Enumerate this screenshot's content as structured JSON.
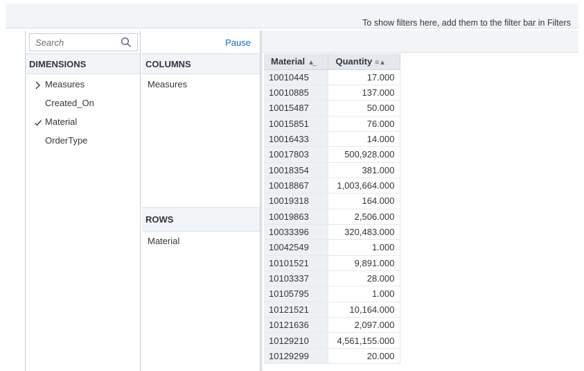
{
  "filter_bar": {
    "message": "To show filters here, add them to the filter bar in Filters"
  },
  "dimensions": {
    "search_placeholder": "Search",
    "header": "DIMENSIONS",
    "items": [
      {
        "label": "Measures",
        "marker": "›"
      },
      {
        "label": "Created_On",
        "marker": ""
      },
      {
        "label": "Material",
        "marker": "✓"
      },
      {
        "label": "OrderType",
        "marker": ""
      }
    ]
  },
  "builder": {
    "pause_label": "Pause",
    "columns_header": "COLUMNS",
    "columns_items": [
      "Measures"
    ],
    "rows_header": "ROWS",
    "rows_items": [
      "Material"
    ]
  },
  "table": {
    "headers": {
      "material": "Material",
      "quantity": "Quantity"
    },
    "rows": [
      {
        "material": "10010445",
        "quantity": "17.000"
      },
      {
        "material": "10010885",
        "quantity": "137.000"
      },
      {
        "material": "10015487",
        "quantity": "50.000"
      },
      {
        "material": "10015851",
        "quantity": "76.000"
      },
      {
        "material": "10016433",
        "quantity": "14.000"
      },
      {
        "material": "10017803",
        "quantity": "500,928.000"
      },
      {
        "material": "10018354",
        "quantity": "381.000"
      },
      {
        "material": "10018867",
        "quantity": "1,003,664.000"
      },
      {
        "material": "10019318",
        "quantity": "164.000"
      },
      {
        "material": "10019863",
        "quantity": "2,506.000"
      },
      {
        "material": "10033396",
        "quantity": "320,483.000"
      },
      {
        "material": "10042549",
        "quantity": "1.000"
      },
      {
        "material": "10101521",
        "quantity": "9,891.000"
      },
      {
        "material": "10103337",
        "quantity": "28.000"
      },
      {
        "material": "10105795",
        "quantity": "1.000"
      },
      {
        "material": "10121521",
        "quantity": "10,164.000"
      },
      {
        "material": "10121636",
        "quantity": "2,097.000"
      },
      {
        "material": "10129210",
        "quantity": "4,561,155.000"
      },
      {
        "material": "10129299",
        "quantity": "20.000"
      }
    ]
  },
  "icons": {
    "search": "search-icon",
    "material_sort": "sort-ascending-icon",
    "quantity_sort": "sort-filter-icon"
  },
  "colors": {
    "accent": "#0a6ed1",
    "header_bg": "#f2f5f8",
    "table_header_bg": "#e5e9ed"
  }
}
